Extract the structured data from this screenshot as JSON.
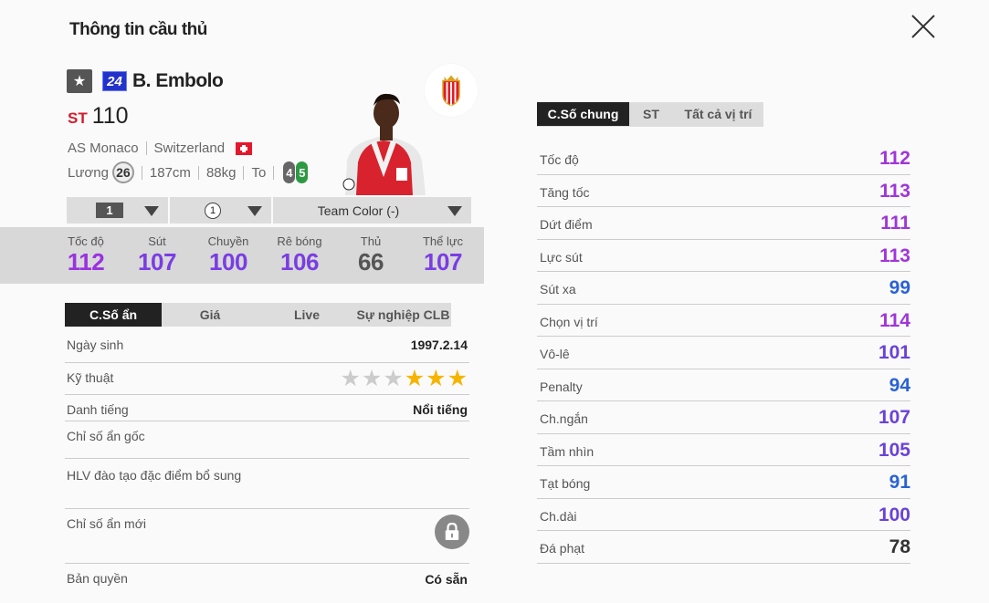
{
  "header": {
    "title": "Thông tin cầu thủ"
  },
  "player": {
    "season_number": "24",
    "name": "B. Embolo",
    "position": "ST",
    "ovr": "110",
    "club": "AS Monaco",
    "nation": "Switzerland",
    "salary_label": "Lương",
    "salary": "26",
    "height": "187cm",
    "weight": "88kg",
    "build": "To",
    "weak_foot": "4",
    "strong_foot": "5"
  },
  "selectors": {
    "level": "1",
    "team_color_rank": "1",
    "team_color": "Team Color (-)"
  },
  "main_stats": [
    {
      "label": "Tốc độ",
      "value": "112",
      "color": "#9932e0"
    },
    {
      "label": "Sút",
      "value": "107",
      "color": "#7a3de3"
    },
    {
      "label": "Chuyền",
      "value": "100",
      "color": "#7a3de3"
    },
    {
      "label": "Rê bóng",
      "value": "106",
      "color": "#7a3de3"
    },
    {
      "label": "Thủ",
      "value": "66",
      "color": "#555555"
    },
    {
      "label": "Thể lực",
      "value": "107",
      "color": "#7a3de3"
    }
  ],
  "left_tabs": [
    "C.Số ẩn",
    "Giá",
    "Live",
    "Sự nghiệp CLB"
  ],
  "hidden": {
    "birth_label": "Ngày sinh",
    "birth": "1997.2.14",
    "skill_label": "Kỹ thuật",
    "skill_stars": 3,
    "skill_stars_total": 6,
    "reputation_label": "Danh tiếng",
    "reputation": "Nổi tiếng",
    "base_label": "Chỉ số ẩn gốc",
    "coach_label": "HLV đào tạo đặc điểm bổ sung",
    "new_label": "Chỉ số ẩn mới",
    "rights_label": "Bản quyền",
    "rights": "Có sẵn"
  },
  "right_tabs": [
    "C.Số chung",
    "ST",
    "Tất cả vị trí"
  ],
  "attributes": [
    {
      "label": "Tốc độ",
      "value": "112",
      "color": "#a035d8"
    },
    {
      "label": "Tăng tốc",
      "value": "113",
      "color": "#a035d8"
    },
    {
      "label": "Dứt điểm",
      "value": "111",
      "color": "#a035d8"
    },
    {
      "label": "Lực sút",
      "value": "113",
      "color": "#a035d8"
    },
    {
      "label": "Sút xa",
      "value": "99",
      "color": "#2a62d6"
    },
    {
      "label": "Chọn vị trí",
      "value": "114",
      "color": "#a035d8"
    },
    {
      "label": "Vô-lê",
      "value": "101",
      "color": "#6a42d8"
    },
    {
      "label": "Penalty",
      "value": "94",
      "color": "#2a62d6"
    },
    {
      "label": "Ch.ngắn",
      "value": "107",
      "color": "#6a42d8"
    },
    {
      "label": "Tầm nhìn",
      "value": "105",
      "color": "#6a42d8"
    },
    {
      "label": "Tạt bóng",
      "value": "91",
      "color": "#2a62d6"
    },
    {
      "label": "Ch.dài",
      "value": "100",
      "color": "#6a42d8"
    },
    {
      "label": "Đá phạt",
      "value": "78",
      "color": "#333333"
    }
  ]
}
